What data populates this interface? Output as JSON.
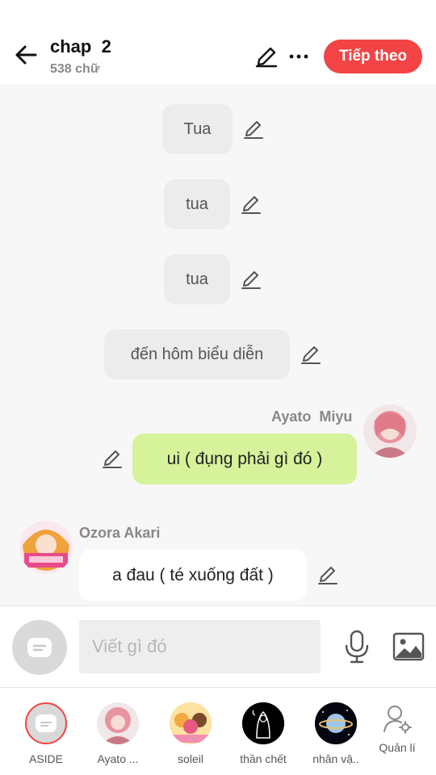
{
  "header": {
    "title": "chap  2",
    "word_count": "538 chữ",
    "next_label": "Tiếp theo",
    "next_color": "#f24445"
  },
  "messages": [
    {
      "type": "narration",
      "text": "Tua"
    },
    {
      "type": "narration",
      "text": "tua"
    },
    {
      "type": "narration",
      "text": "tua"
    },
    {
      "type": "narration",
      "text": "đến hôm biểu diễn"
    },
    {
      "type": "right",
      "speaker": "Ayato  Miyu",
      "text": "ui ( đụng phải gì đó )"
    },
    {
      "type": "left",
      "speaker": "Ozora Akari",
      "text": "a đau ( té xuống đất )"
    }
  ],
  "composer": {
    "placeholder": "Viết gì đó",
    "value": ""
  },
  "characters": [
    {
      "label": "ASIDE",
      "icon": "message-icon"
    },
    {
      "label": "Ayato ...",
      "icon": "avatar"
    },
    {
      "label": "soleil",
      "icon": "avatar"
    },
    {
      "label": "thần chết",
      "icon": "avatar"
    },
    {
      "label": "nhân vậ..",
      "icon": "avatar"
    },
    {
      "label": "Quản lí",
      "icon": "user-settings-icon"
    }
  ],
  "colors": {
    "accent": "#f24445",
    "right_bubble": "#d6f29b",
    "narration_bubble": "#ececec",
    "chat_background": "#f7f7f7"
  }
}
